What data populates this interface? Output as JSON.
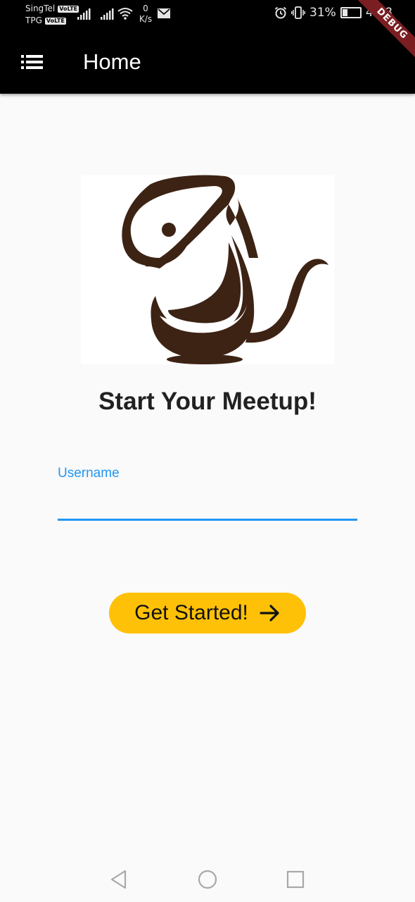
{
  "status_bar": {
    "carrier1": "SingTel",
    "carrier2": "TPG",
    "volte_badge": "VoLTE",
    "net_speed_value": "0",
    "net_speed_unit": "K/s",
    "battery_percent": "31%",
    "battery_level": 0.31,
    "time": "4:58",
    "debug_label": "DEBUG"
  },
  "app_bar": {
    "title": "Home",
    "menu_icon": "menu-list-icon"
  },
  "main": {
    "logo_icon": "rat-logo",
    "logo_color": "#3d2314",
    "headline": "Start Your Meetup!",
    "username_label": "Username",
    "username_value": "",
    "button_label": "Get Started!",
    "button_icon": "arrow-right-icon"
  },
  "colors": {
    "accent": "#2196f3",
    "button": "#ffc107",
    "app_bar": "#000000",
    "debug_banner": "#7a1e22"
  },
  "nav_bar": {
    "back_icon": "back-triangle-icon",
    "home_icon": "home-circle-icon",
    "recents_icon": "recents-square-icon"
  }
}
